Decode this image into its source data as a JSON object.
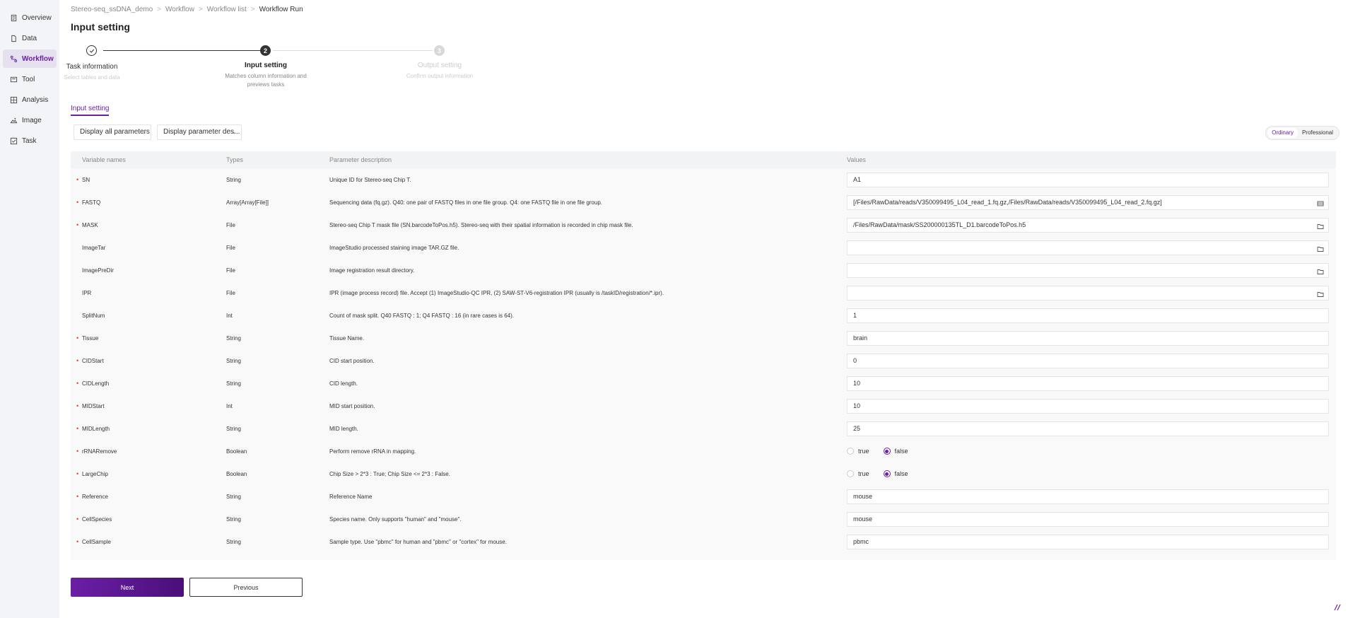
{
  "sidebar": {
    "items": [
      {
        "label": "Overview",
        "icon": "document-icon",
        "active": false
      },
      {
        "label": "Data",
        "icon": "file-icon",
        "active": false
      },
      {
        "label": "Workflow",
        "icon": "workflow-icon",
        "active": true
      },
      {
        "label": "Tool",
        "icon": "tool-icon",
        "active": false
      },
      {
        "label": "Analysis",
        "icon": "analysis-icon",
        "active": false
      },
      {
        "label": "Image",
        "icon": "image-icon",
        "active": false
      },
      {
        "label": "Task",
        "icon": "task-icon",
        "active": false
      }
    ]
  },
  "breadcrumb": {
    "items": [
      "Stereo-seq_ssDNA_demo",
      "Workflow",
      "Workflow list",
      "Workflow Run"
    ]
  },
  "page_title": "Input setting",
  "steps": [
    {
      "number": "",
      "title": "Task information",
      "desc": "Select tables and data",
      "state": "done"
    },
    {
      "number": "2",
      "title": "Input setting",
      "desc": "Matches column information and previews tasks",
      "state": "active"
    },
    {
      "number": "3",
      "title": "Output setting",
      "desc": "Confirm output information",
      "state": "pending"
    }
  ],
  "section_tab": "Input setting",
  "filters": {
    "params": "Display all parameters",
    "desc": "Display parameter des..."
  },
  "mode": {
    "ordinary": "Ordinary",
    "professional": "Professional",
    "selected": "Ordinary"
  },
  "table": {
    "headers": {
      "name": "Variable names",
      "type": "Types",
      "desc": "Parameter description",
      "value": "Values"
    },
    "rows": [
      {
        "name": "SN",
        "type": "String",
        "desc": "Unique ID for Stereo-seq Chip T.",
        "value": "A1",
        "required": true,
        "kind": "text"
      },
      {
        "name": "FASTQ",
        "type": "Array[Array[File]]",
        "desc": "Sequencing data (fq.gz). Q40: one pair of FASTQ files in one file group. Q4: one FASTQ file in one file group.",
        "value": "[/Files/RawData/reads/V350099495_L04_read_1.fq.gz,/Files/RawData/reads/V350099495_L04_read_2.fq.gz]",
        "required": true,
        "kind": "array"
      },
      {
        "name": "MASK",
        "type": "File",
        "desc": "Stereo-seq Chip T mask file (SN.barcodeToPos.h5). Stereo-seq with their spatial information is recorded in chip mask file.",
        "value": "/Files/RawData/mask/SS200000135TL_D1.barcodeToPos.h5",
        "required": true,
        "kind": "file"
      },
      {
        "name": "ImageTar",
        "type": "File",
        "desc": "ImageStudio processed staining image TAR.GZ file.",
        "value": "",
        "required": false,
        "kind": "file"
      },
      {
        "name": "ImagePreDir",
        "type": "File",
        "desc": "Image registration result directory.",
        "value": "",
        "required": false,
        "kind": "file"
      },
      {
        "name": "IPR",
        "type": "File",
        "desc": "IPR (image process record) file. Accept (1) ImageStudio-QC IPR, (2) SAW-ST-V6-registration IPR (usually is /taskID/registration/*.ipr).",
        "value": "",
        "required": false,
        "kind": "file"
      },
      {
        "name": "SplitNum",
        "type": "Int",
        "desc": "Count of mask split. Q40 FASTQ : 1; Q4 FASTQ : 16 (in rare cases is 64).",
        "value": "1",
        "required": false,
        "kind": "text"
      },
      {
        "name": "Tissue",
        "type": "String",
        "desc": "Tissue Name.",
        "value": "brain",
        "required": true,
        "kind": "text"
      },
      {
        "name": "CIDStart",
        "type": "String",
        "desc": "CID start position.",
        "value": "0",
        "required": true,
        "kind": "text"
      },
      {
        "name": "CIDLength",
        "type": "String",
        "desc": "CID length.",
        "value": "10",
        "required": true,
        "kind": "text"
      },
      {
        "name": "MIDStart",
        "type": "Int",
        "desc": "MID start position.",
        "value": "10",
        "required": true,
        "kind": "text"
      },
      {
        "name": "MIDLength",
        "type": "String",
        "desc": "MID length.",
        "value": "25",
        "required": true,
        "kind": "text"
      },
      {
        "name": "rRNARemove",
        "type": "Boolean",
        "desc": "Perform remove rRNA in mapping.",
        "value": "false",
        "required": true,
        "kind": "bool"
      },
      {
        "name": "LargeChip",
        "type": "Boolean",
        "desc": "Chip Size > 2*3 : True; Chip Size <= 2*3 : False.",
        "value": "false",
        "required": true,
        "kind": "bool"
      },
      {
        "name": "Reference",
        "type": "String",
        "desc": "Reference Name",
        "value": "mouse",
        "required": true,
        "kind": "text"
      },
      {
        "name": "CellSpecies",
        "type": "String",
        "desc": "Species name. Only supports \"human\" and \"mouse\".",
        "value": "mouse",
        "required": true,
        "kind": "text"
      },
      {
        "name": "CellSample",
        "type": "String",
        "desc": "Sample type. Use \"pbmc\" for human and \"pbmc\" or \"cortex\" for mouse.",
        "value": "pbmc",
        "required": true,
        "kind": "text"
      }
    ]
  },
  "bool_labels": {
    "true": "true",
    "false": "false"
  },
  "buttons": {
    "next": "Next",
    "previous": "Previous"
  },
  "colors": {
    "accent": "#6b1fa5",
    "required": "#e0403a"
  }
}
